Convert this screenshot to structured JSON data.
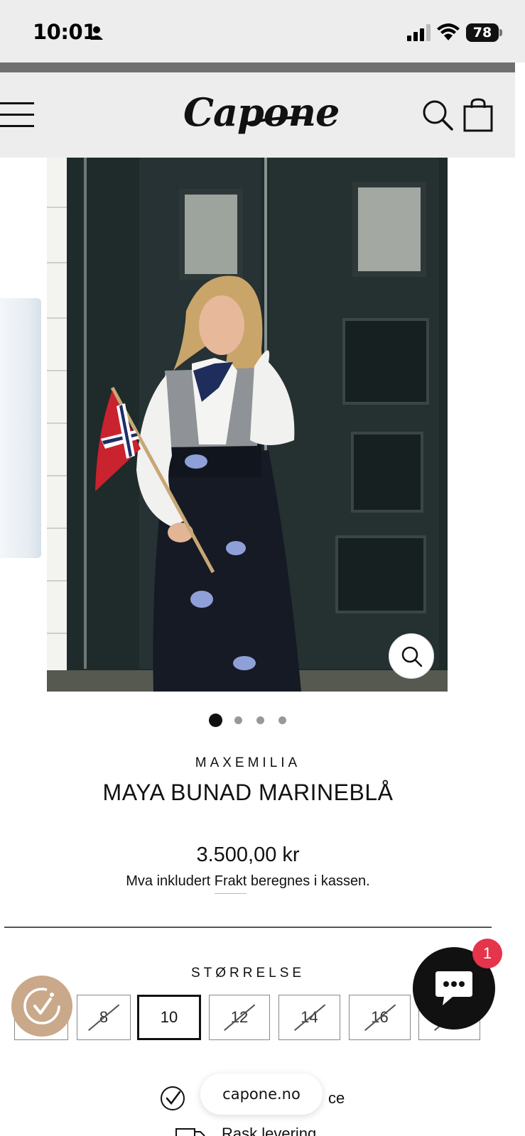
{
  "status_bar": {
    "time": "10:01",
    "battery": "78"
  },
  "header": {
    "logo": "Capone"
  },
  "gallery": {
    "dot_count": 4,
    "active_dot": 0
  },
  "product": {
    "vendor": "MAXEMILIA",
    "title": "MAYA BUNAD MARINEBLÅ",
    "price": "3.500,00 kr",
    "tax_prefix": "Mva inkludert",
    "tax_link": "Frakt",
    "tax_suffix": "beregnes i kassen."
  },
  "size": {
    "label": "STØRRELSE",
    "options": [
      {
        "label": "",
        "state": "sold-out"
      },
      {
        "label": "8",
        "state": "sold-out"
      },
      {
        "label": "10",
        "state": "selected"
      },
      {
        "label": "12",
        "state": "sold-out"
      },
      {
        "label": "14",
        "state": "sold-out"
      },
      {
        "label": "16",
        "state": "sold-out"
      },
      {
        "label": "",
        "state": "sold-out"
      }
    ]
  },
  "chat": {
    "unread_count": "1"
  },
  "features": {
    "first_fragment": "ce",
    "second_fragment": "Rask levering"
  },
  "browser": {
    "url": "capone.no"
  },
  "colors": {
    "header_bg": "#ededed",
    "chat_bg": "#111111",
    "badge_red": "#e5344b",
    "reviews_tan": "#c9a98a"
  }
}
